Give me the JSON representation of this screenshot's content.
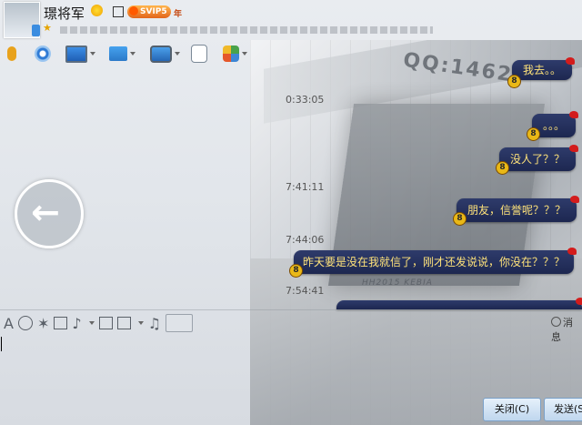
{
  "header": {
    "contact_name": "璟将军",
    "vip_label": "SVIP5",
    "vip_suffix": "年",
    "star_icon": "★"
  },
  "skin": {
    "brand_text": "QQ:1462",
    "sub_text": "HH2015 KEBIA"
  },
  "back_button": {
    "arrow": "←"
  },
  "timestamps": [
    "0:33:05",
    "7:41:11",
    "7:44:06",
    "7:54:41"
  ],
  "messages": [
    {
      "text": "我去。。"
    },
    {
      "text": "。。。"
    },
    {
      "text": "没人了？？"
    },
    {
      "text": "朋友，信誉呢？？？"
    },
    {
      "text": "昨天要是没在我就信了，刚才还发说说，你没在？？？"
    },
    {
      "text": ""
    }
  ],
  "badge_number": "8",
  "input_toolbar": {
    "font_icon": "A",
    "music_icon": "♫",
    "message_record_label": "消息"
  },
  "buttons": {
    "close_label": "关闭(C)",
    "send_label": "发送(S"
  },
  "colors": {
    "bubble_bg": "#243060",
    "bubble_text": "#ffe37a",
    "button_bg": "#cfe0f2"
  }
}
